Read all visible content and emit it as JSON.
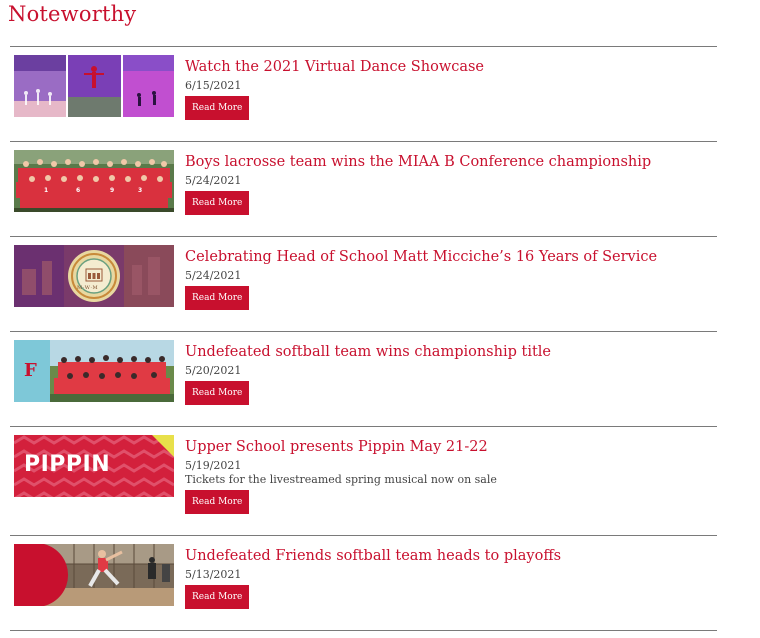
{
  "section": {
    "title": "Noteworthy"
  },
  "colors": {
    "accent": "#c8102e",
    "divider": "#7a7a7a"
  },
  "items": [
    {
      "headline": "Watch the 2021 Virtual Dance Showcase",
      "date": "6/15/2021",
      "description": "",
      "button_label": "Read More",
      "image": "dance-showcase-collage"
    },
    {
      "headline": "Boys lacrosse team wins the MIAA B Conference championship",
      "date": "5/24/2021",
      "description": "",
      "button_label": "Read More",
      "image": "lacrosse-team-photo"
    },
    {
      "headline": "Celebrating Head of School Matt Micciche’s 16 Years of Service",
      "date": "5/24/2021",
      "description": "",
      "button_label": "Read More",
      "image": "school-seal-graphic",
      "image_text": "M·W·M"
    },
    {
      "headline": "Undefeated softball team wins championship title",
      "date": "5/20/2021",
      "description": "",
      "button_label": "Read More",
      "image": "softball-team-photo"
    },
    {
      "headline": "Upper School presents Pippin May 21-22",
      "date": "5/19/2021",
      "description": "Tickets for the livestreamed spring musical now on sale",
      "button_label": "Read More",
      "image": "pippin-banner",
      "image_text": "PIPPIN"
    },
    {
      "headline": "Undefeated Friends softball team heads to playoffs",
      "date": "5/13/2021",
      "description": "",
      "button_label": "Read More",
      "image": "softball-pitcher-photo"
    }
  ]
}
